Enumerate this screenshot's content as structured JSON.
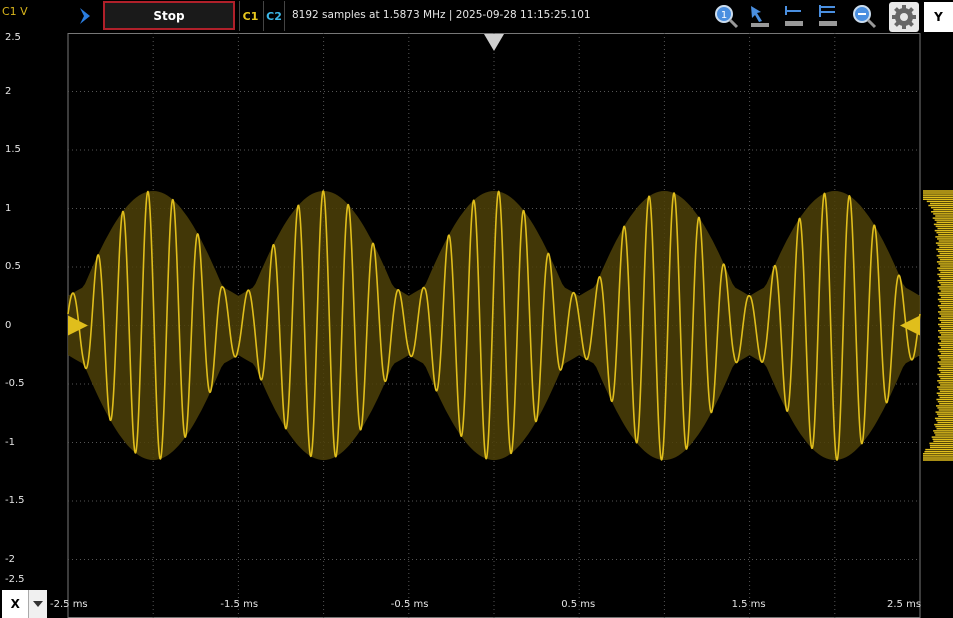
{
  "toolbar": {
    "channel_unit": "C1 V",
    "stop_label": "Stop",
    "c1_label": "C1",
    "c2_label": "C2",
    "acquisition_info": "8192 samples at 1.5873 MHz | 2025-09-28 11:15:25.101",
    "y_button": "Y",
    "icons": [
      "play-icon",
      "zoom-in-icon",
      "cursor-icon",
      "zoom-x-icon",
      "zoom-xy-icon",
      "zoom-out-icon",
      "gear-icon"
    ]
  },
  "x_axis_selector": {
    "label": "X"
  },
  "colors": {
    "trace": "#e0be1c",
    "envelope": "#4e4108",
    "c1": "#e8c81e",
    "c2": "#3cb8e8",
    "stop_border": "#b0202a"
  },
  "chart_data": {
    "type": "line",
    "title": "",
    "xlabel": "",
    "ylabel": "C1 V",
    "xlim": [
      -2.5,
      2.5
    ],
    "ylim": [
      -2.5,
      2.5
    ],
    "grid": true,
    "x_tick_labels": [
      "-2.5 ms",
      "-1.5 ms",
      "-0.5 ms",
      "0.5 ms",
      "1.5 ms",
      "2.5 ms"
    ],
    "x_tick_values": [
      -2.5,
      -1.5,
      -0.5,
      0.5,
      1.5,
      2.5
    ],
    "y_tick_labels": [
      "2.5",
      "2",
      "1.5",
      "1",
      "0.5",
      "0",
      "-0.5",
      "-1",
      "-1.5",
      "-2",
      "-2.5"
    ],
    "y_tick_values": [
      2.5,
      2,
      1.5,
      1,
      0.5,
      0,
      -0.5,
      -1,
      -1.5,
      -2,
      -2.5
    ],
    "series": [
      {
        "peak_amplitude": 1.15,
        "modulation_period_ms": 1.0,
        "carrier_frequency_khz": 6.8,
        "offset": 0
      }
    ]
  }
}
